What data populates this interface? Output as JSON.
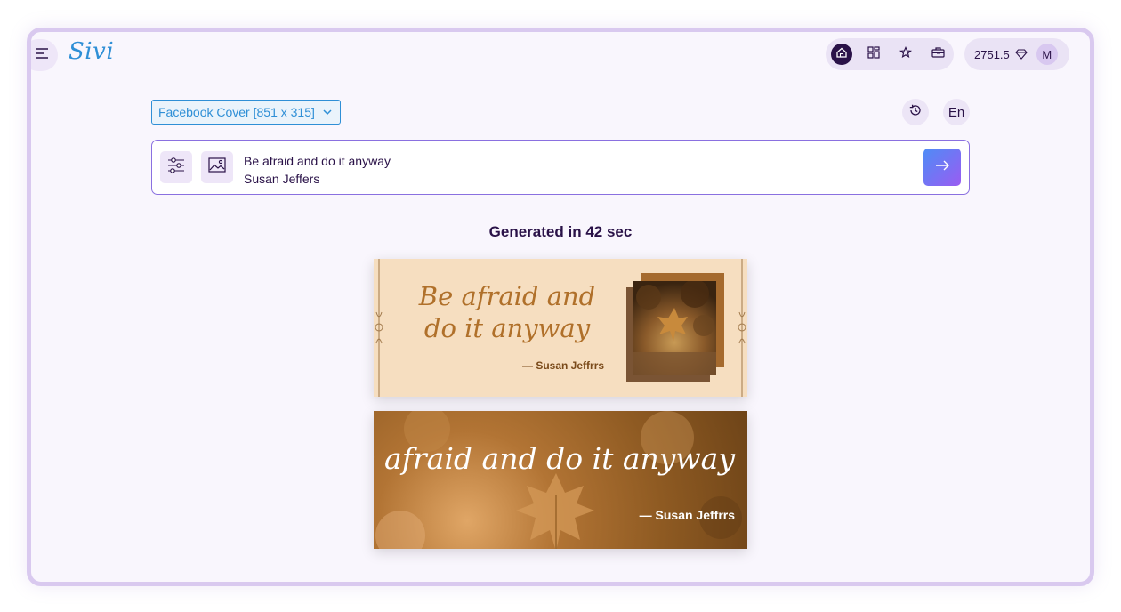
{
  "header": {
    "logo": "Sivi",
    "credits": "2751.5",
    "avatar_initial": "M",
    "nav_icons": [
      "home-icon",
      "grid-icon",
      "star-icon",
      "briefcase-icon"
    ]
  },
  "toolbar": {
    "size_select": "Facebook Cover [851 x 315]",
    "language": "En"
  },
  "prompt": {
    "line1": "Be afraid and do it anyway",
    "line2": "Susan Jeffers"
  },
  "result": {
    "generated_label": "Generated in 42 sec"
  },
  "designs": [
    {
      "quote": "Be afraid and do it anyway",
      "author": "— Susan Jeffrrs"
    },
    {
      "quote": "Be afraid and do it anyway",
      "author": "— Susan Jeffrrs"
    }
  ],
  "colors": {
    "accent": "#2f8fd6",
    "dark": "#2a1248",
    "frame": "#d9c9ef"
  }
}
